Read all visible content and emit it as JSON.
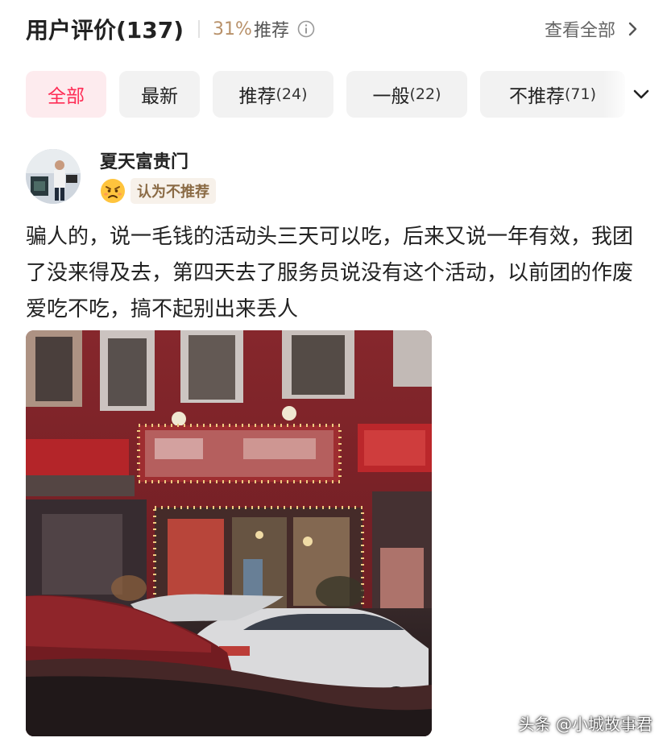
{
  "header": {
    "title": "用户评价(137)",
    "recommend_rate": "31%",
    "recommend_label": "推荐",
    "info_icon": "info-icon",
    "view_all": "查看全部"
  },
  "filters": [
    {
      "label": "全部",
      "count": ""
    },
    {
      "label": "最新",
      "count": ""
    },
    {
      "label": "推荐",
      "count": "(24)"
    },
    {
      "label": "一般",
      "count": "(22)"
    },
    {
      "label": "不推荐",
      "count": "(71)"
    }
  ],
  "review": {
    "username": "夏天富贵门",
    "verdict": "认为不推荐",
    "verdict_icon": "angry-face-icon",
    "text": "骗人的，说一毛钱的活动头三天可以吃，后来又说一年有效，我团了没来得及去，第四天去了服务员说没有这个活动，以前团的作废爱吃不吃，搞不起别出来丢人"
  },
  "watermark": "头条 @小城故事君",
  "colors": {
    "accent": "#fe2c55",
    "active_chip_bg": "#fdebee",
    "rate": "#b8916a",
    "tag_bg": "#f7f1ea"
  }
}
